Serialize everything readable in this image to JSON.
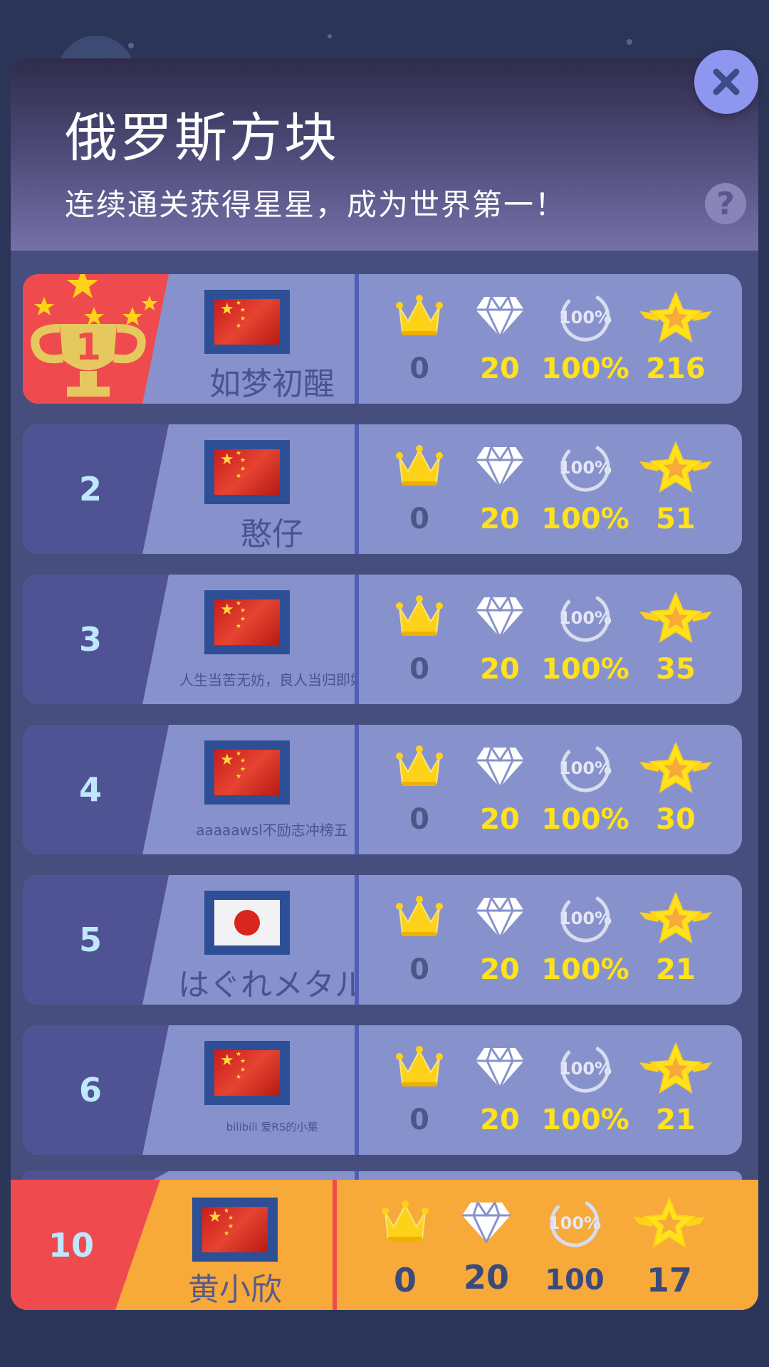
{
  "header": {
    "title": "俄罗斯方块",
    "subtitle": "连续通关获得星星，成为世界第一！",
    "help_label": "?",
    "close_label": "✕"
  },
  "colors": {
    "panel": "#464e7e",
    "row_bg": "#8792cc",
    "rank_bg": "#4f5393",
    "gold": "#ffe21a",
    "first_place_red": "#ef4b4e",
    "me_orange": "#f7a93a"
  },
  "leaderboard": [
    {
      "rank": "1",
      "flag": "china",
      "name": "如梦初醒",
      "crowns": "0",
      "diamonds": "20",
      "percent": "100%",
      "stars": "216"
    },
    {
      "rank": "2",
      "flag": "china",
      "name": "憨仔",
      "crowns": "0",
      "diamonds": "20",
      "percent": "100%",
      "stars": "51"
    },
    {
      "rank": "3",
      "flag": "china",
      "name": "人生当苦无妨，良人当归即好",
      "crowns": "0",
      "diamonds": "20",
      "percent": "100%",
      "stars": "35"
    },
    {
      "rank": "4",
      "flag": "china",
      "name": "aaaaawsl不励志冲榜五",
      "crowns": "0",
      "diamonds": "20",
      "percent": "100%",
      "stars": "30"
    },
    {
      "rank": "5",
      "flag": "japan",
      "name": "はぐれメタル",
      "crowns": "0",
      "diamonds": "20",
      "percent": "100%",
      "stars": "21"
    },
    {
      "rank": "6",
      "flag": "china",
      "name": "bilibili 爱RS的小葉",
      "crowns": "0",
      "diamonds": "20",
      "percent": "100%",
      "stars": "21"
    }
  ],
  "my_entry": {
    "rank": "10",
    "flag": "china",
    "name": "黄小欣",
    "crowns": "0",
    "diamonds": "20",
    "percent": "100",
    "stars": "17"
  },
  "icons": [
    "crown-icon",
    "diamond-icon",
    "percent-100-icon",
    "winged-star-icon",
    "trophy-icon",
    "help-icon",
    "close-icon"
  ]
}
